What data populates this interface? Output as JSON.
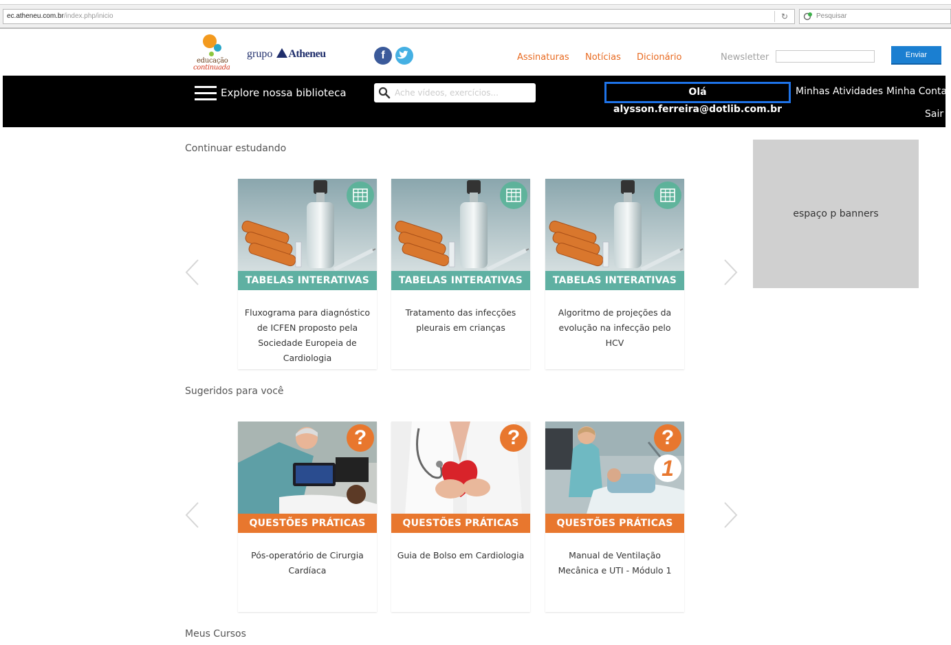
{
  "browser": {
    "url_host": "ec.atheneu.com.br",
    "url_path": "/index.php/inicio",
    "search_placeholder": "Pesquisar"
  },
  "header": {
    "logo_line1": "educação",
    "logo_line2": "continuada",
    "grupo_label": "grupo",
    "atheneu_label": "Atheneu",
    "facebook_glyph": "f",
    "nav": [
      "Assinaturas",
      "Notícias",
      "Dicionário"
    ],
    "newsletter_label": "Newsletter",
    "newsletter_value": "",
    "send_label": "Enviar"
  },
  "bar": {
    "explore_label": "Explore nossa biblioteca",
    "search_placeholder": "Ache vídeos, exercícios...",
    "greeting": "Olá alysson.ferreira@dotlib.com.br",
    "activities": "Minhas Atividades",
    "account": "Minha Conta",
    "logout": "Sair"
  },
  "sections": {
    "continue_title": "Continuar estudando",
    "suggested_title": "Sugeridos para você",
    "courses_title": "Meus Cursos"
  },
  "continue_cards": [
    {
      "category": "TABELAS INTERATIVAS",
      "title": "Fluxograma para diagnóstico de ICFEN proposto pela Sociedade Europeia de Cardiologia"
    },
    {
      "category": "TABELAS INTERATIVAS",
      "title": "Tratamento das infecções pleurais em crianças"
    },
    {
      "category": "TABELAS INTERATIVAS",
      "title": "Algoritmo de projeções da evolução na infecção pelo HCV"
    }
  ],
  "suggested_cards": [
    {
      "category": "QUESTÕES PRÁTICAS",
      "title": "Pós-operatório de Cirurgia Cardíaca",
      "badge": "?"
    },
    {
      "category": "QUESTÕES PRÁTICAS",
      "title": "Guia de Bolso em Cardiologia",
      "badge": "?"
    },
    {
      "category": "QUESTÕES PRÁTICAS",
      "title": "Manual de Ventilação Mecânica e UTI - Módulo 1",
      "badge": "?",
      "module_badge": "1"
    }
  ],
  "banner": {
    "label": "espaço p banners"
  },
  "colors": {
    "accent_orange": "#e8691f",
    "teal": "#5fb0a2",
    "blue": "#1b7fd1",
    "bar": "#000000"
  }
}
